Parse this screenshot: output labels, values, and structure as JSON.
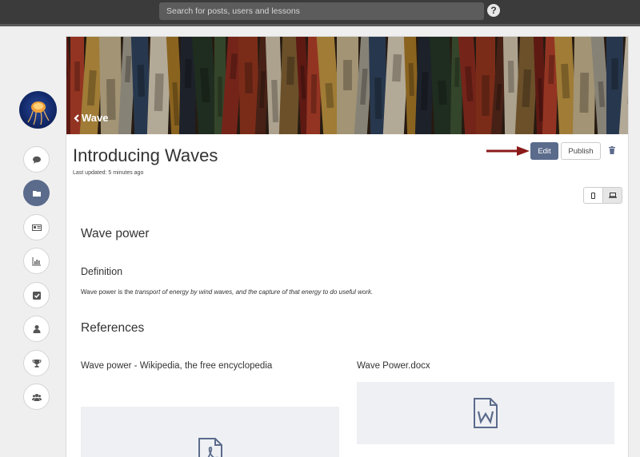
{
  "topbar": {
    "search_placeholder": "Search for posts, users and lessons",
    "help_label": "?"
  },
  "sidebar": {
    "items": [
      {
        "name": "comments",
        "icon": "comment-icon"
      },
      {
        "name": "files",
        "icon": "folder-icon",
        "active": true
      },
      {
        "name": "id-card",
        "icon": "id-card-icon"
      },
      {
        "name": "analytics",
        "icon": "bar-chart-icon"
      },
      {
        "name": "tasks",
        "icon": "checkbox-icon"
      },
      {
        "name": "profile",
        "icon": "user-icon"
      },
      {
        "name": "achievements",
        "icon": "trophy-icon"
      },
      {
        "name": "groups",
        "icon": "users-icon"
      }
    ]
  },
  "banner": {
    "back_label": "Wave"
  },
  "lesson": {
    "title": "Introducing Waves",
    "last_updated": "Last updated: 5 minutes ago",
    "edit_label": "Edit",
    "publish_label": "Publish"
  },
  "content": {
    "section_title": "Wave power",
    "definition_heading": "Definition",
    "definition_lead": "Wave power is the ",
    "definition_italic": "transport of energy by wind waves, and the capture of that energy to do useful work.",
    "references_heading": "References",
    "references": [
      {
        "title": "Wave power - Wikipedia, the free encyclopedia",
        "icon": "pdf-file-icon"
      },
      {
        "title": "Wave Power.docx",
        "icon": "word-file-icon"
      }
    ]
  },
  "colors": {
    "accent": "#5b6b8c",
    "arrow": "#8b1a1a",
    "topbar": "#3b3b3b"
  }
}
